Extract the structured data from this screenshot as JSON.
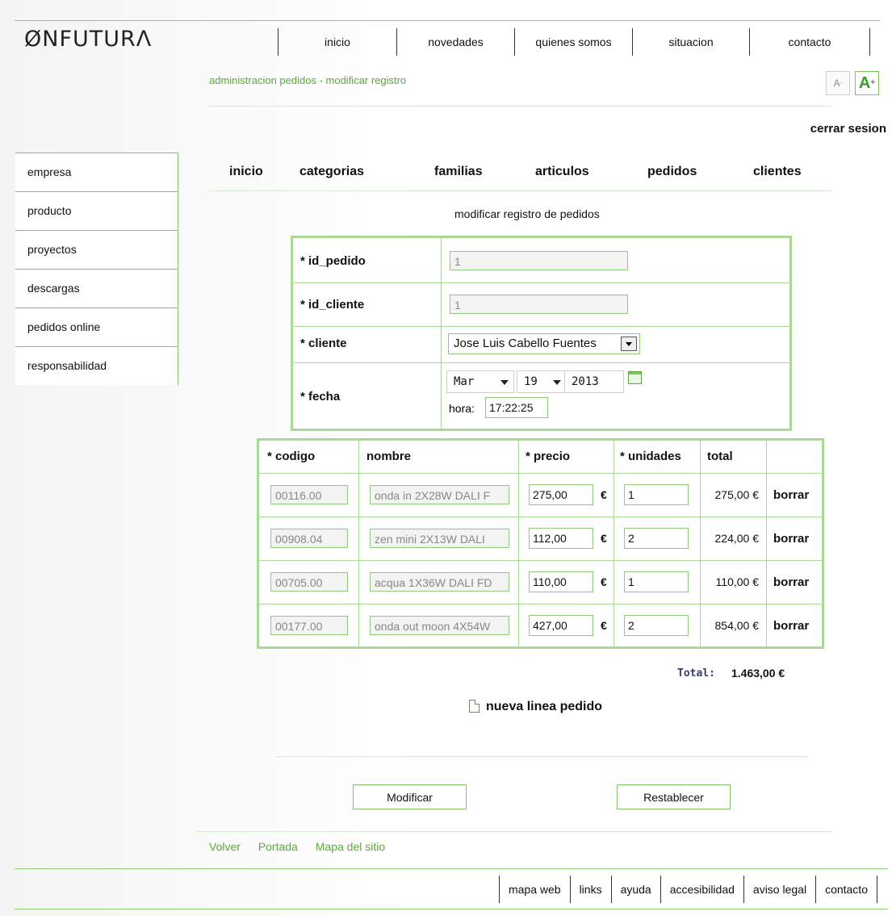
{
  "logo": "ØNFUTURΛ",
  "top_nav": [
    "inicio",
    "novedades",
    "quienes somos",
    "situacion",
    "contacto"
  ],
  "breadcrumb": "administracion pedidos - modificar registro",
  "font_controls": {
    "smaller_icon": "font-decrease-icon",
    "larger_icon": "font-increase-icon"
  },
  "logout": "cerrar sesion",
  "sidebar": [
    "empresa",
    "producto",
    "proyectos",
    "descargas",
    "pedidos online",
    "responsabilidad"
  ],
  "sub_nav": [
    "inicio",
    "categorias",
    "familias",
    "articulos",
    "pedidos",
    "clientes"
  ],
  "section_title": "modificar registro de pedidos",
  "form": {
    "id_pedido": {
      "label": "* id_pedido",
      "value": "1"
    },
    "id_cliente": {
      "label": "* id_cliente",
      "value": "1"
    },
    "cliente": {
      "label": "* cliente",
      "value": "Jose Luis Cabello Fuentes"
    },
    "fecha": {
      "label": "* fecha",
      "month": "Mar",
      "day": "19",
      "year": "2013",
      "hora_label": "hora:",
      "hora": "17:22:25"
    }
  },
  "items": {
    "headers": [
      "* codigo",
      "nombre",
      "* precio",
      "* unidades",
      "total"
    ],
    "rows": [
      {
        "codigo": "00116.00",
        "nombre": "onda in 2X28W DALI F",
        "precio": "275,00",
        "unidades": "1",
        "total": "275,00 €",
        "delete": "borrar"
      },
      {
        "codigo": "00908.04",
        "nombre": "zen mini 2X13W DALI",
        "precio": "112,00",
        "unidades": "2",
        "total": "224,00 €",
        "delete": "borrar"
      },
      {
        "codigo": "00705.00",
        "nombre": "acqua 1X36W DALI FD",
        "precio": "110,00",
        "unidades": "1",
        "total": "110,00 €",
        "delete": "borrar"
      },
      {
        "codigo": "00177.00",
        "nombre": "onda out moon 4X54W",
        "precio": "427,00",
        "unidades": "2",
        "total": "854,00 €",
        "delete": "borrar"
      }
    ],
    "currency": "€"
  },
  "total": {
    "label": "Total:",
    "value": "1.463,00 €"
  },
  "new_line": "nueva linea pedido",
  "buttons": {
    "modify": "Modificar",
    "reset": "Restablecer"
  },
  "footer_links": [
    "Volver",
    "Portada",
    "Mapa del sitio"
  ],
  "bottom_nav": [
    "mapa web",
    "links",
    "ayuda",
    "accesibilidad",
    "aviso legal",
    "contacto"
  ],
  "colors": {
    "accent": "#7fc467",
    "link_green": "#5aaa3a",
    "border_green": "#a8d995",
    "total_label": "#333f70"
  }
}
